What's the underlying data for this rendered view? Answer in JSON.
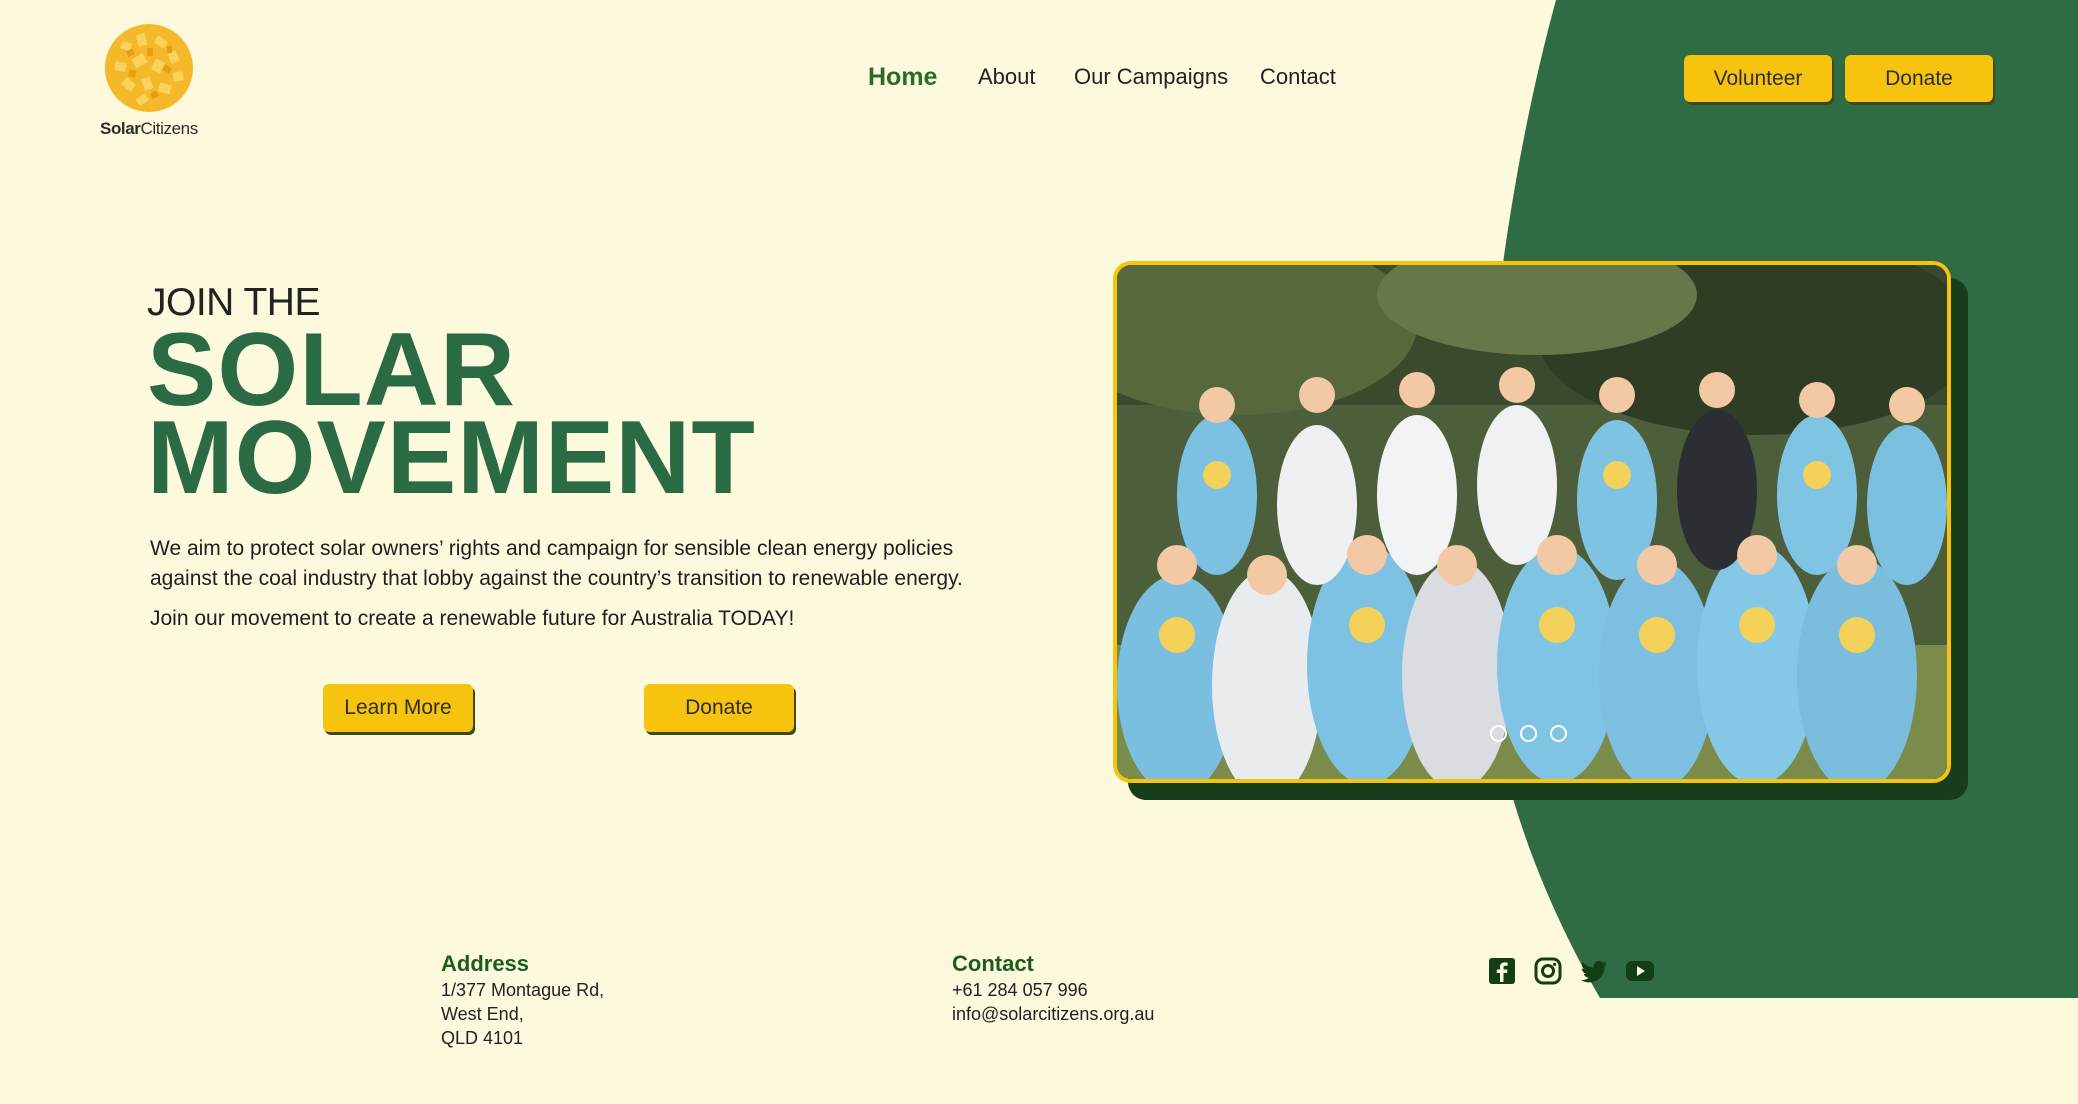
{
  "brand": {
    "logo_strong": "Solar",
    "logo_light": "Citizens",
    "logo_icon": "sun-mosaic-icon"
  },
  "nav": {
    "items": [
      {
        "label": "Home",
        "active": true
      },
      {
        "label": "About",
        "active": false
      },
      {
        "label": "Our Campaigns",
        "active": false
      },
      {
        "label": "Contact",
        "active": false
      }
    ]
  },
  "header_buttons": {
    "volunteer": "Volunteer",
    "donate": "Donate"
  },
  "hero": {
    "kicker": "JOIN THE",
    "headline_line1": "SOLAR",
    "headline_line2": "MOVEMENT",
    "paragraph1": "We aim to protect solar owners’ rights and campaign for sensible clean energy policies against the coal industry that lobby against the country’s transition to renewable energy.",
    "paragraph2": "Join our movement to create a renewable future for Australia TODAY!",
    "learn_more_label": "Learn More",
    "donate_label": "Donate"
  },
  "carousel": {
    "slide_count": 3,
    "active_slide": 0
  },
  "footer": {
    "address_title": "Address",
    "address_lines": [
      "1/377 Montague Rd,",
      "West End,",
      "QLD 4101"
    ],
    "contact_title": "Contact",
    "phone": "+61 284 057 996",
    "email": "info@solarcitizens.org.au",
    "social": [
      "facebook-icon",
      "instagram-icon",
      "twitter-icon",
      "youtube-icon"
    ]
  },
  "colors": {
    "background": "#fdf9dc",
    "green": "#2b6b43",
    "dark_green": "#173e1c",
    "accent_yellow": "#f6c30f"
  }
}
